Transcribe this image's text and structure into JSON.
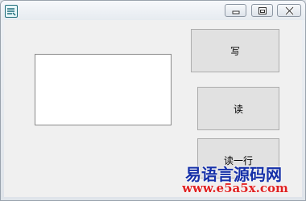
{
  "window": {
    "title": "",
    "icon": "app-icon",
    "controls": [
      "minimize-icon",
      "maximize-icon",
      "close-icon"
    ]
  },
  "text_box": {
    "value": ""
  },
  "buttons": {
    "write_label": "写",
    "read_label": "读",
    "read_line_label": "读一行"
  },
  "watermark": {
    "title": "易语言源码网",
    "url": "www.e5a5x.com"
  }
}
